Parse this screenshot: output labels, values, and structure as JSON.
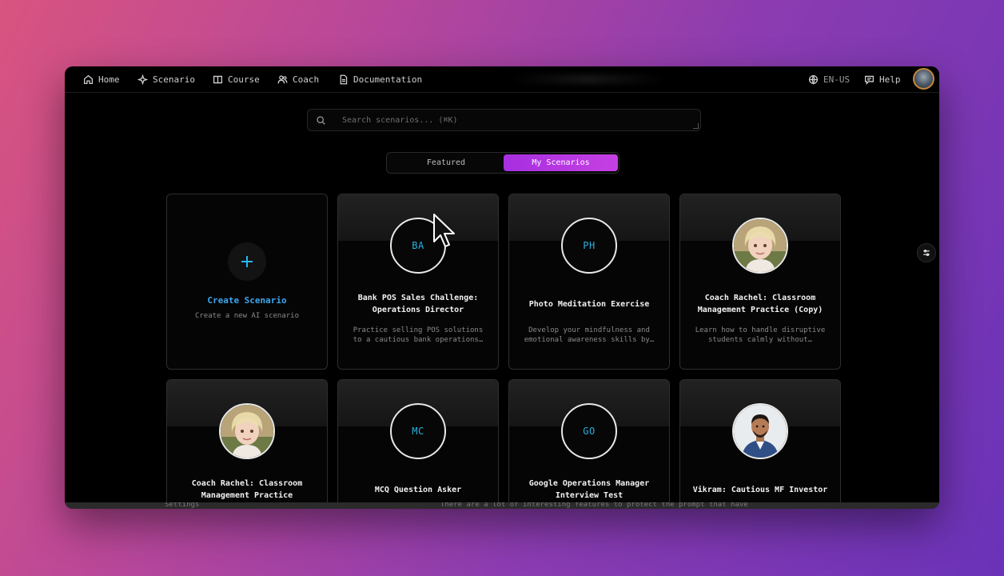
{
  "nav": {
    "home": "Home",
    "scenario": "Scenario",
    "course": "Course",
    "coach": "Coach",
    "documentation": "Documentation",
    "language": "EN-US",
    "help": "Help"
  },
  "search": {
    "placeholder": "Search scenarios... (⌘K)"
  },
  "tabs": {
    "featured": "Featured",
    "my_scenarios": "My Scenarios",
    "active": "My Scenarios"
  },
  "create_card": {
    "title": "Create Scenario",
    "subtitle": "Create a new AI scenario"
  },
  "cards": [
    {
      "initials": "BA",
      "title": "Bank POS Sales Challenge: Operations Director",
      "description": "Practice selling POS solutions to a cautious bank operations…"
    },
    {
      "initials": "PH",
      "title": "Photo Meditation Exercise",
      "description": "Develop your mindfulness and emotional awareness skills by…"
    },
    {
      "avatar": "woman-avatar",
      "title": "Coach Rachel: Classroom Management Practice (Copy)",
      "description": "Learn how to handle disruptive students calmly without…"
    },
    {
      "avatar": "woman-avatar",
      "title": "Coach Rachel: Classroom Management Practice",
      "description": ""
    },
    {
      "initials": "MC",
      "title": "MCQ Question Asker",
      "description": ""
    },
    {
      "initials": "GO",
      "title": "Google Operations Manager Interview Test",
      "description": ""
    },
    {
      "avatar": "man-avatar",
      "title": "Vikram: Cautious MF Investor",
      "description": ""
    }
  ],
  "bottom": {
    "settings": "Settings",
    "message": "There are a lot of interesting features to protect the prompt that have"
  },
  "colors": {
    "accent": "#b436e2",
    "initials": "#27b0e0",
    "create": "#3fa7f0"
  }
}
